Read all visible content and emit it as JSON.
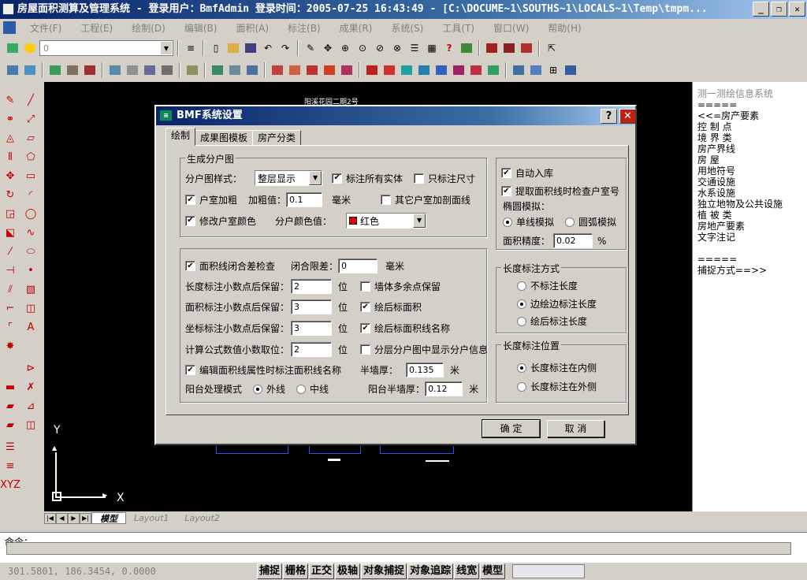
{
  "window": {
    "title": "房屋面积测算及管理系统 - 登录用户：BmfAdmin   登录时间：2005-07-25 16:43:49 - [C:\\DOCUME~1\\SOUTHS~1\\LOCALS~1\\Temp\\tmpm..."
  },
  "menu": [
    "文件(F)",
    "工程(E)",
    "绘制(D)",
    "编辑(B)",
    "面积(A)",
    "标注(B)",
    "成果(R)",
    "系统(S)",
    "工具(T)",
    "窗口(W)",
    "帮助(H)"
  ],
  "toolbar": {
    "layer_value": "0"
  },
  "canvas": {
    "drawing_caption": "阳溪花园二期2号",
    "axis_y": "Y",
    "axis_x": "X"
  },
  "right_panel": {
    "items": [
      "测一测绘信息系统",
      "=====",
      "<<=房产要素",
      "控  制  点",
      "境  界  类",
      "房产界线",
      "房      屋",
      "用地符号",
      "交通设施",
      "水系设施",
      "独立地物及公共设施",
      "植  被  类",
      "房地产要素",
      "文字注记",
      "",
      "=====",
      "捕捉方式==>>"
    ]
  },
  "layout_tabs": [
    "模型",
    "Layout1",
    "Layout2"
  ],
  "command": {
    "prompt": "命令："
  },
  "status": {
    "coords": "301.5801, 186.3454, 0.0000",
    "toggles": [
      "捕捉",
      "栅格",
      "正交",
      "极轴",
      "对象捕捉",
      "对象追踪",
      "线宽",
      "模型"
    ]
  },
  "dialog": {
    "title": "BMF系统设置",
    "help": "?",
    "close": "✕",
    "tabs": [
      "绘制",
      "成果图模板",
      "房产分类"
    ],
    "active_tab": 0,
    "group_generate": {
      "label": "生成分户图",
      "style_label": "分户图样式：",
      "style_value": "整层显示",
      "mark_all_entities": "标注所有实体",
      "mark_size_only": "只标注尺寸",
      "thicken": "户室加粗",
      "thicken_value_label": "加粗值：",
      "thicken_value": "0.1",
      "mm": "毫米",
      "other_thicken": "其它户室加剖面线",
      "modify_color": "修改户室颜色",
      "color_label": "分户颜色值：",
      "color_value": "红色",
      "color_hex": "#e00000"
    },
    "group_precision": {
      "closure_check": "面积线闭合差检查",
      "closure_limit_label": "闭合限差：",
      "closure_limit": "0",
      "closure_unit": "毫米",
      "len_decimals_label": "长度标注小数点后保留：",
      "len_decimals": "2",
      "area_decimals_label": "面积标注小数点后保留：",
      "area_decimals": "3",
      "coord_decimals_label": "坐标标注小数点后保留：",
      "coord_decimals": "3",
      "formula_decimals_label": "计算公式数值小数取位：",
      "formula_decimals": "2",
      "digit_unit": "位",
      "wall_extra": "墙体多余点保留",
      "draw_area": "绘后标面积",
      "draw_area_name": "绘后标面积线名称",
      "layered_info": "分层分户图中显示分户信息",
      "edit_props": "编辑面积线属性时标注面积线名称",
      "half_wall_label": "半墙厚：",
      "half_wall": "0.135",
      "meter": "米",
      "balcony_mode_label": "阳台处理模式",
      "outer": "外线",
      "middle": "中线",
      "balcony_half_wall_label": "阳台半墙厚：",
      "balcony_half_wall": "0.12"
    },
    "group_auto": {
      "auto_store": "自动入库",
      "check_room": "提取面积线时检查户室号",
      "ellipse_label": "椭圆模拟：",
      "polyline": "单线模拟",
      "arc": "圆弧模拟",
      "area_precision_label": "面积精度：",
      "area_precision": "0.02",
      "percent": "%"
    },
    "group_len_style": {
      "label": "长度标注方式",
      "none": "不标注长度",
      "while_drawing": "边绘边标注长度",
      "after_drawing": "绘后标注长度"
    },
    "group_len_pos": {
      "label": "长度标注位置",
      "inside": "长度标注在内侧",
      "outside": "长度标注在外侧"
    },
    "ok": "确 定",
    "cancel": "取 消"
  }
}
